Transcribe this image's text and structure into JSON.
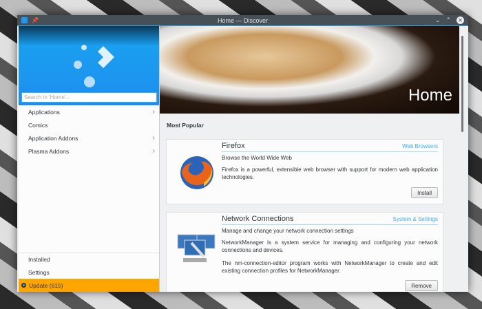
{
  "window": {
    "title": "Home — Discover"
  },
  "sidebar": {
    "search_placeholder": "Search in 'Home'...",
    "items": [
      {
        "label": "Applications"
      },
      {
        "label": "Comics"
      },
      {
        "label": "Application Addons"
      },
      {
        "label": "Plasma Addons"
      }
    ],
    "bottom": {
      "installed": "Installed",
      "settings": "Settings",
      "update": "Update (615)"
    }
  },
  "main": {
    "banner_title": "Home",
    "section_title": "Most Popular",
    "apps": [
      {
        "name": "Firefox",
        "category": "Web Browsers",
        "summary": "Browse the World Wide Web",
        "description": [
          "Firefox is a powerful, extensible web browser with support for modern web application technologies."
        ],
        "action": "Install"
      },
      {
        "name": "Network Connections",
        "category": "System & Settings",
        "summary": "Manage and change your network connection settings",
        "description": [
          "NetworkManager is a system service for managing and configuring your network connections and devices.",
          "The nm-connection-editor program works with NetworkManager to create and edit existing connection profiles for NetworkManager."
        ],
        "action": "Remove"
      }
    ]
  },
  "colors": {
    "accent": "#3daee9",
    "update": "#ffa500"
  }
}
